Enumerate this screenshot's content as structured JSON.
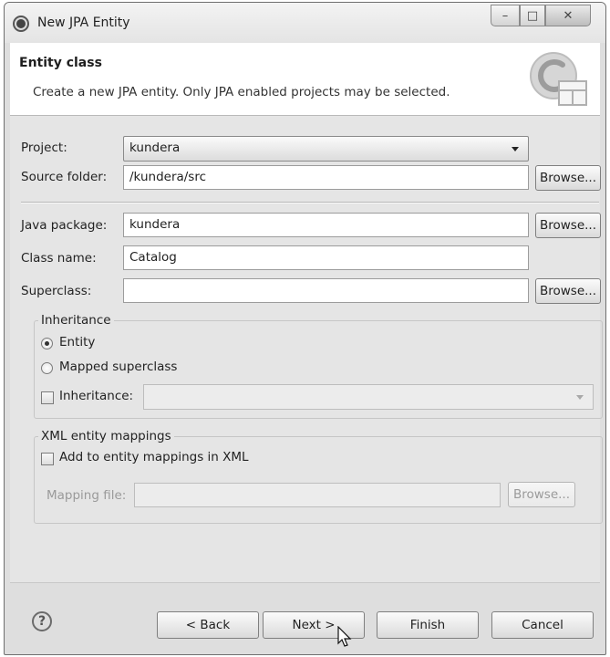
{
  "window": {
    "title": "New JPA Entity"
  },
  "window_controls": {
    "minimize": "–",
    "maximize": "□",
    "close": "✕"
  },
  "header": {
    "title": "Entity class",
    "description": "Create a new JPA entity. Only JPA enabled projects may be selected.",
    "icon": "wizard-class-icon"
  },
  "form": {
    "project": {
      "label": "Project:",
      "value": "kundera"
    },
    "source_folder": {
      "label": "Source folder:",
      "value": "/kundera/src",
      "browse": "Browse..."
    },
    "java_package": {
      "label": "Java package:",
      "value": "kundera",
      "browse": "Browse..."
    },
    "class_name": {
      "label": "Class name:",
      "value": "Catalog"
    },
    "superclass": {
      "label": "Superclass:",
      "value": "",
      "browse": "Browse..."
    }
  },
  "inheritance": {
    "title": "Inheritance",
    "entity": "Entity",
    "mapped_superclass": "Mapped superclass",
    "inheritance_checkbox": "Inheritance:",
    "selected": "Entity"
  },
  "xml": {
    "title": "XML entity mappings",
    "add_checkbox": "Add to entity mappings in XML",
    "mapping_file_label": "Mapping file:",
    "mapping_file_value": "",
    "browse": "Browse..."
  },
  "footer": {
    "help": "?",
    "back": "< Back",
    "next": "Next >",
    "finish": "Finish",
    "cancel": "Cancel"
  }
}
